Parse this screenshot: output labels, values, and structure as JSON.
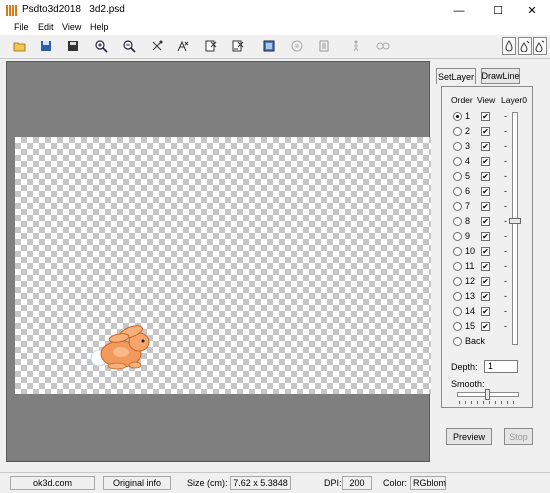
{
  "window": {
    "title": "Psdto3d2018   3d2.psd",
    "minimize": "—",
    "maximize": "☐",
    "close": "✕"
  },
  "menu": [
    "File",
    "Edit",
    "View",
    "Help"
  ],
  "toolbar": {
    "icons": [
      "open-icon",
      "save-icon",
      "save-as-icon",
      "zoom-in-icon",
      "zoom-out-icon",
      "tool-x-icon",
      "tool-ax-icon",
      "tool-layer-x-icon",
      "tool-layer-ax-icon",
      "render-icon",
      "circle-icon",
      "tool-layer-icon",
      "walk-icon",
      "link-icon"
    ],
    "right_icons": [
      "mode-1-icon",
      "mode-2-icon",
      "mode-3-icon"
    ]
  },
  "tabs": [
    "SetLayer",
    "DrawLine"
  ],
  "layer_panel": {
    "headers": [
      "Order",
      "View",
      "Layer0"
    ],
    "rows": [
      "1",
      "2",
      "3",
      "4",
      "5",
      "6",
      "7",
      "8",
      "9",
      "10",
      "11",
      "12",
      "13",
      "14",
      "15",
      "Back"
    ],
    "selected": 0,
    "dash": "-"
  },
  "depth": {
    "label": "Depth:",
    "value": "1"
  },
  "smooth": {
    "label": "Smooth:"
  },
  "buttons": {
    "preview": "Preview",
    "stop": "Stop"
  },
  "status": {
    "site": "ok3d.com",
    "original_info": "Original info",
    "size_label": "Size (cm):",
    "size_value": "7.62 x 5.3848",
    "dpi_label": "DPI:",
    "dpi_value": "200",
    "color_label": "Color:",
    "color_value": "RGblom"
  },
  "colors": {
    "canvas_bg": "#7f7f7f",
    "accent": "#d97a14",
    "rabbit": "#f29a5b"
  }
}
